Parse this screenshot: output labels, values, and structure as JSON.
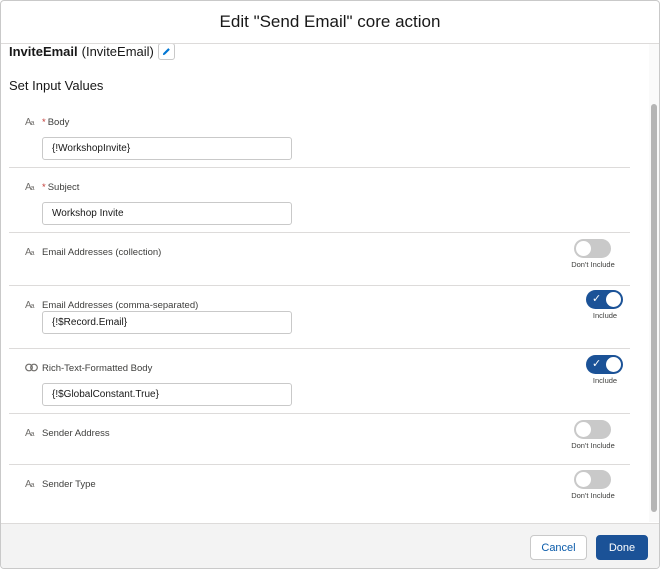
{
  "modal": {
    "title": "Edit \"Send Email\" core action",
    "action_name_bold": "InviteEmail",
    "action_name_api": "(InviteEmail)",
    "section_title": "Set Input Values"
  },
  "fields": [
    {
      "label": "Body",
      "required": "*",
      "value": "{!WorkshopInvite}"
    },
    {
      "label": "Subject",
      "required": "*",
      "value": "Workshop Invite"
    },
    {
      "label": "Email Addresses (collection)",
      "toggle_label": "Don't Include",
      "toggle_state": "off"
    },
    {
      "label": "Email Addresses (comma-separated)",
      "value": "{!$Record.Email}",
      "toggle_label": "Include",
      "toggle_state": "on"
    },
    {
      "label": "Rich-Text-Formatted Body",
      "value": "{!$GlobalConstant.True}",
      "toggle_label": "Include",
      "toggle_state": "on"
    },
    {
      "label": "Sender Address",
      "toggle_label": "Don't Include",
      "toggle_state": "off"
    },
    {
      "label": "Sender Type",
      "toggle_label": "Don't Include",
      "toggle_state": "off"
    }
  ],
  "icons": {
    "text_type": "text-type-icon",
    "boolean_type": "boolean-type-icon",
    "edit": "pencil-icon",
    "check": "checkmark-icon"
  },
  "footer": {
    "cancel_label": "Cancel",
    "done_label": "Done"
  },
  "colors": {
    "brand": "#1b5297",
    "toggle_off": "#c9c9c9",
    "link": "#0b5cab"
  }
}
